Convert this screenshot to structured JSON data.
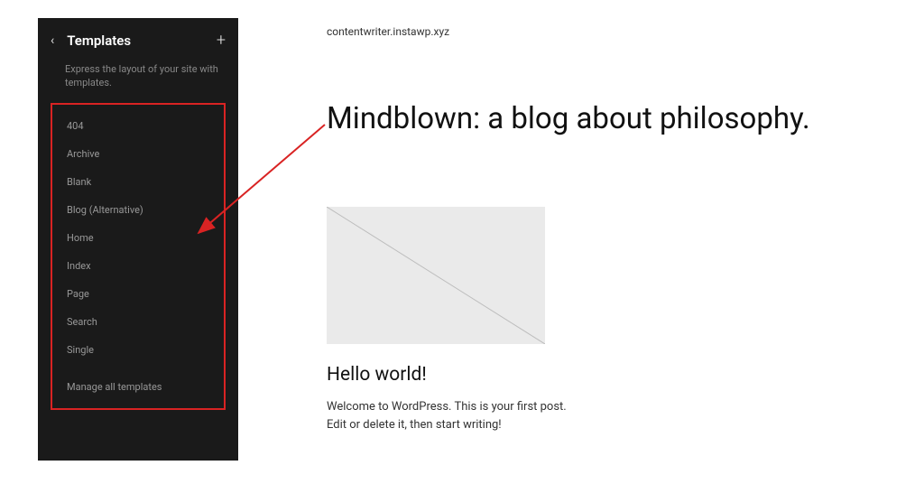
{
  "sidebar": {
    "title": "Templates",
    "description": "Express the layout of your site with templates.",
    "items": [
      {
        "label": "404"
      },
      {
        "label": "Archive"
      },
      {
        "label": "Blank"
      },
      {
        "label": "Blog (Alternative)"
      },
      {
        "label": "Home"
      },
      {
        "label": "Index"
      },
      {
        "label": "Page"
      },
      {
        "label": "Search"
      },
      {
        "label": "Single"
      }
    ],
    "manage_label": "Manage all templates"
  },
  "content": {
    "site_url": "contentwriter.instawp.xyz",
    "blog_title": "Mindblown: a blog about philosophy.",
    "post_title": "Hello world!",
    "post_excerpt_line1": "Welcome to WordPress. This is your first post.",
    "post_excerpt_line2": "Edit or delete it, then start writing!"
  },
  "colors": {
    "highlight": "#d92323",
    "sidebar_bg": "#1a1a1a"
  }
}
